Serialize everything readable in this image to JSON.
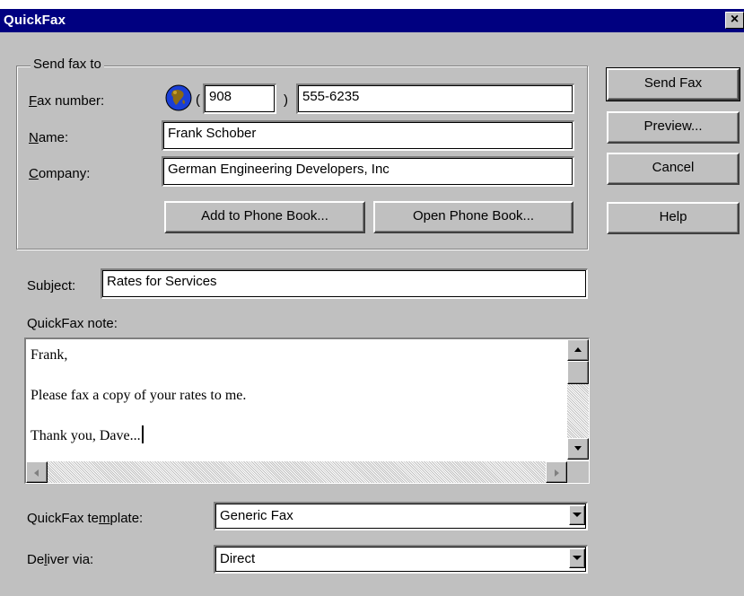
{
  "window": {
    "title": "QuickFax",
    "close_glyph": "×"
  },
  "send_to": {
    "legend": "Send fax to",
    "fax_label": "Fax number:",
    "fax_label_mnemonic": "F",
    "area_open": "(",
    "area_code": "908",
    "area_close": ")",
    "fax_number": "555-6235",
    "name_label": "Name:",
    "name_value": "Frank Schober",
    "company_label": "Company:",
    "company_value": "German Engineering Developers, Inc",
    "add_phonebook_label": "Add to Phone Book...",
    "open_phonebook_label": "Open Phone Book..."
  },
  "buttons": {
    "send_fax": "Send Fax",
    "preview": "Preview...",
    "cancel": "Cancel",
    "help": "Help"
  },
  "subject": {
    "label": "Subject:",
    "value": "Rates for Services"
  },
  "note": {
    "label": "QuickFax note:",
    "lines": [
      "Frank,",
      "Please fax a copy of your rates to me.",
      "Thank you, Dave..."
    ]
  },
  "template": {
    "label": "QuickFax template:",
    "selected": "Generic Fax"
  },
  "deliver": {
    "label": "Deliver via:",
    "selected": "Direct"
  },
  "icons": {
    "phone_globe": "globe-icon",
    "close": "close-icon"
  },
  "colors": {
    "titlebar": "#000080",
    "face": "#c0c0c0"
  }
}
